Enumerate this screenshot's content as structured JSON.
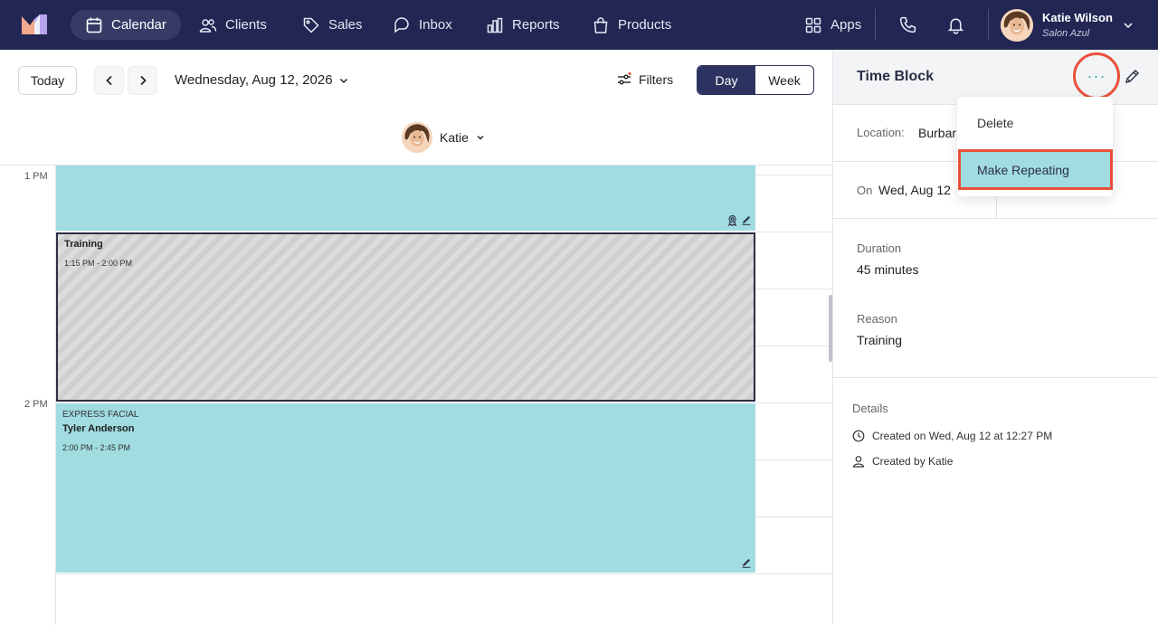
{
  "nav": {
    "items": [
      {
        "label": "Calendar",
        "icon": "calendar-icon"
      },
      {
        "label": "Clients",
        "icon": "users-icon"
      },
      {
        "label": "Sales",
        "icon": "tag-icon"
      },
      {
        "label": "Inbox",
        "icon": "chat-icon"
      },
      {
        "label": "Reports",
        "icon": "bar-chart-icon"
      },
      {
        "label": "Products",
        "icon": "bag-icon"
      }
    ],
    "apps_label": "Apps",
    "user_name": "Katie Wilson",
    "salon_name": "Salon Azul"
  },
  "toolbar": {
    "today_label": "Today",
    "date_label": "Wednesday, Aug 12, 2026",
    "filters_label": "Filters",
    "view_day": "Day",
    "view_week": "Week",
    "staff_name": "Katie"
  },
  "calendar": {
    "time_labels": [
      "1 PM",
      "2 PM"
    ],
    "training": {
      "title": "Training",
      "time": "1:15 PM - 2:00 PM"
    },
    "facial": {
      "service": "EXPRESS FACIAL",
      "client": "Tyler Anderson",
      "time": "2:00 PM - 2:45 PM"
    }
  },
  "panel": {
    "title": "Time Block",
    "more_label": "···",
    "location_label": "Location:",
    "location_value": "Burbar",
    "on_label": "On",
    "on_value": "Wed, Aug 12",
    "duration_label": "Duration",
    "duration_value": "45 minutes",
    "reason_label": "Reason",
    "reason_value": "Training",
    "details_label": "Details",
    "created_on": "Created on Wed, Aug 12 at 12:27 PM",
    "created_by": "Created by Katie"
  },
  "dropdown": {
    "delete_label": "Delete",
    "repeat_label": "Make Repeating"
  },
  "colors": {
    "nav_bg": "#212653",
    "appointment": "#a0dce0",
    "highlight": "#e8503a"
  }
}
